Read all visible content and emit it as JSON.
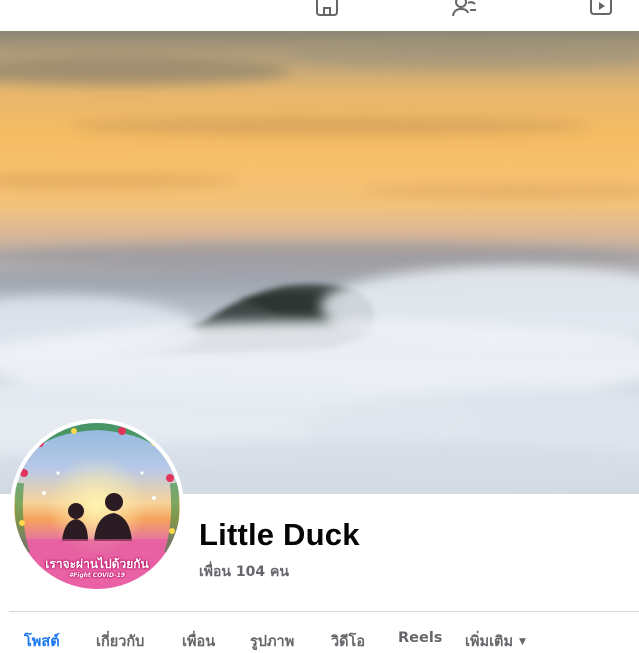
{
  "top_nav": {
    "icons": [
      "home-icon",
      "friends-icon",
      "watch-icon"
    ]
  },
  "profile": {
    "name": "Little Duck",
    "friends_text": "เพื่อน 104 คน",
    "avatar_caption": "เราจะผ่านไปด้วยกัน",
    "avatar_subcaption": "#Fight COVID-19"
  },
  "tabs": [
    {
      "label": "โพสต์",
      "active": true
    },
    {
      "label": "เกี่ยวกับ",
      "active": false
    },
    {
      "label": "เพื่อน",
      "active": false
    },
    {
      "label": "รูปภาพ",
      "active": false
    },
    {
      "label": "วิดีโอ",
      "active": false
    },
    {
      "label": "Reels",
      "active": false
    },
    {
      "label": "เพิ่มเติม",
      "active": false
    }
  ],
  "colors": {
    "active_tab": "#1877f2",
    "tab_text": "#65676b",
    "name_text": "#050505"
  }
}
